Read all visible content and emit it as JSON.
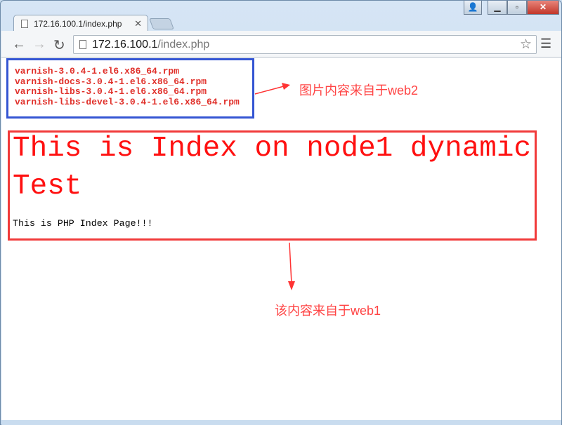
{
  "browser": {
    "tab_title": "172.16.100.1/index.php",
    "url_host": "172.16.100.1",
    "url_path": "/index.php",
    "icons": [
      "document-icon",
      "close-icon",
      "back-icon",
      "forward-icon",
      "reload-icon",
      "star-icon",
      "menu-icon",
      "user-icon",
      "minimize-icon",
      "maximize-icon",
      "window-close-icon"
    ]
  },
  "page": {
    "files": [
      "varnish-3.0.4-1.el6.x86_64.rpm",
      "varnish-docs-3.0.4-1.el6.x86_64.rpm",
      "varnish-libs-3.0.4-1.el6.x86_64.rpm",
      "varnish-libs-devel-3.0.4-1.el6.x86_64.rpm"
    ],
    "heading": "This is Index on node1 dynamic Test",
    "subtext": "This is PHP Index Page!!!"
  },
  "annotations": {
    "web2": "图片内容来自于web2",
    "web1": "该内容来自于web1",
    "colors": {
      "blue_box": "#3455d3",
      "red_box": "#f13a3a",
      "annotation": "#ff4444"
    }
  }
}
